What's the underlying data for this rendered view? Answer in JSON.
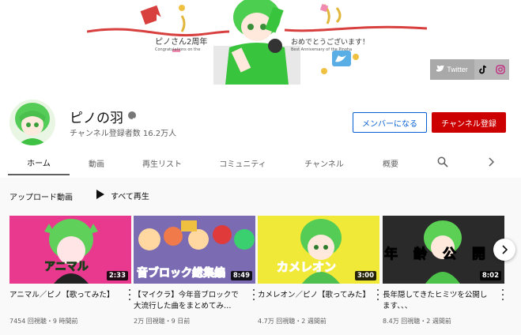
{
  "banner": {
    "text_left": "ピノさん2周年",
    "text_left_small": "Congratulations on the",
    "text_right": "おめでとうございます！",
    "text_right_small": "Best Anniversary of the Pinoha",
    "links": {
      "twitter_label": "Twitter",
      "icons": [
        "twitter-icon",
        "tiktok-icon",
        "instagram-icon"
      ]
    }
  },
  "channel": {
    "name": "ピノの羽",
    "subscribers": "チャンネル登録者数 16.2万人",
    "member_button": "メンバーになる",
    "subscribe_button": "チャンネル登録"
  },
  "tabs": [
    {
      "label": "ホーム",
      "active": true
    },
    {
      "label": "動画"
    },
    {
      "label": "再生リスト"
    },
    {
      "label": "コミュニティ"
    },
    {
      "label": "チャンネル"
    },
    {
      "label": "概要"
    }
  ],
  "section": {
    "title": "アップロード動画",
    "play_all": "すべて再生"
  },
  "videos": [
    {
      "title": "アニマル／ピノ【歌ってみた】",
      "thumb_text": "アニマル",
      "duration": "2:33",
      "meta": "7454 回視聴・9 時間前",
      "bg": "#e8398f"
    },
    {
      "title": "【マイクラ】今年音ブロックで大流行した曲をまとめてみ…",
      "thumb_text": "音ブロック総集編",
      "duration": "8:49",
      "meta": "2万 回視聴・9 日前",
      "bg": "#6b5ea8"
    },
    {
      "title": "カメレオン／ピノ【歌ってみた】",
      "thumb_text": "カメレオン",
      "duration": "3:00",
      "meta": "4.7万 回視聴・2 週間前",
      "bg": "#f0e938"
    },
    {
      "title": "長年隠してきたヒミツを公開します、、、",
      "thumb_text": "年齢公開",
      "duration": "8:02",
      "meta": "8.4万 回視聴・2 週間前",
      "bg": "#2a2a2a"
    }
  ],
  "colors": {
    "subscribe": "#cc0000",
    "member_border": "#065fd4"
  }
}
